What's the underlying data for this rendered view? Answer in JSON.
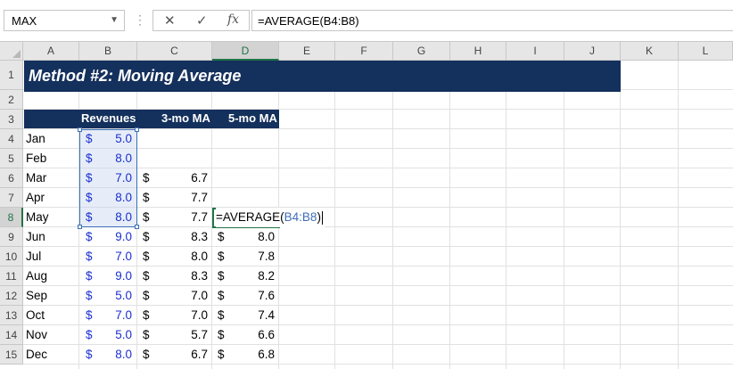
{
  "formula_bar": {
    "name_box": "MAX",
    "cancel_glyph": "✕",
    "enter_glyph": "✓",
    "fx_glyph": "fx",
    "formula": "=AVERAGE(B4:B8)"
  },
  "columns": [
    "A",
    "B",
    "C",
    "D",
    "E",
    "F",
    "G",
    "H",
    "I",
    "J",
    "K",
    "L"
  ],
  "active_column": "D",
  "rows": [
    "1",
    "2",
    "3",
    "4",
    "5",
    "6",
    "7",
    "8",
    "9",
    "10",
    "11",
    "12",
    "13",
    "14",
    "15"
  ],
  "active_row": "8",
  "title": "Method #2: Moving Average",
  "table_headers": {
    "revenues": "Revenues",
    "ma3": "3-mo MA",
    "ma5": "5-mo MA"
  },
  "currency_symbol": "$",
  "data_rows": [
    {
      "month": "Jan",
      "revenue": "5.0",
      "ma3": "",
      "ma5": ""
    },
    {
      "month": "Feb",
      "revenue": "8.0",
      "ma3": "",
      "ma5": ""
    },
    {
      "month": "Mar",
      "revenue": "7.0",
      "ma3": "6.7",
      "ma5": ""
    },
    {
      "month": "Apr",
      "revenue": "8.0",
      "ma3": "7.7",
      "ma5": ""
    },
    {
      "month": "May",
      "revenue": "8.0",
      "ma3": "7.7",
      "ma5": ""
    },
    {
      "month": "Jun",
      "revenue": "9.0",
      "ma3": "8.3",
      "ma5": "8.0"
    },
    {
      "month": "Jul",
      "revenue": "7.0",
      "ma3": "8.0",
      "ma5": "7.8"
    },
    {
      "month": "Aug",
      "revenue": "9.0",
      "ma3": "8.3",
      "ma5": "8.2"
    },
    {
      "month": "Sep",
      "revenue": "5.0",
      "ma3": "7.0",
      "ma5": "7.6"
    },
    {
      "month": "Oct",
      "revenue": "7.0",
      "ma3": "7.0",
      "ma5": "7.4"
    },
    {
      "month": "Nov",
      "revenue": "5.0",
      "ma3": "5.7",
      "ma5": "6.6"
    },
    {
      "month": "Dec",
      "revenue": "8.0",
      "ma3": "6.7",
      "ma5": "6.8"
    }
  ],
  "editing": {
    "prefix": "=AVERAGE(",
    "ref": "B4:B8",
    "suffix": ")"
  },
  "colors": {
    "header_fill": "#14305c",
    "input_blue": "#1a2fd1",
    "active_green": "#217346",
    "ref_blue": "#3d6fb8"
  }
}
